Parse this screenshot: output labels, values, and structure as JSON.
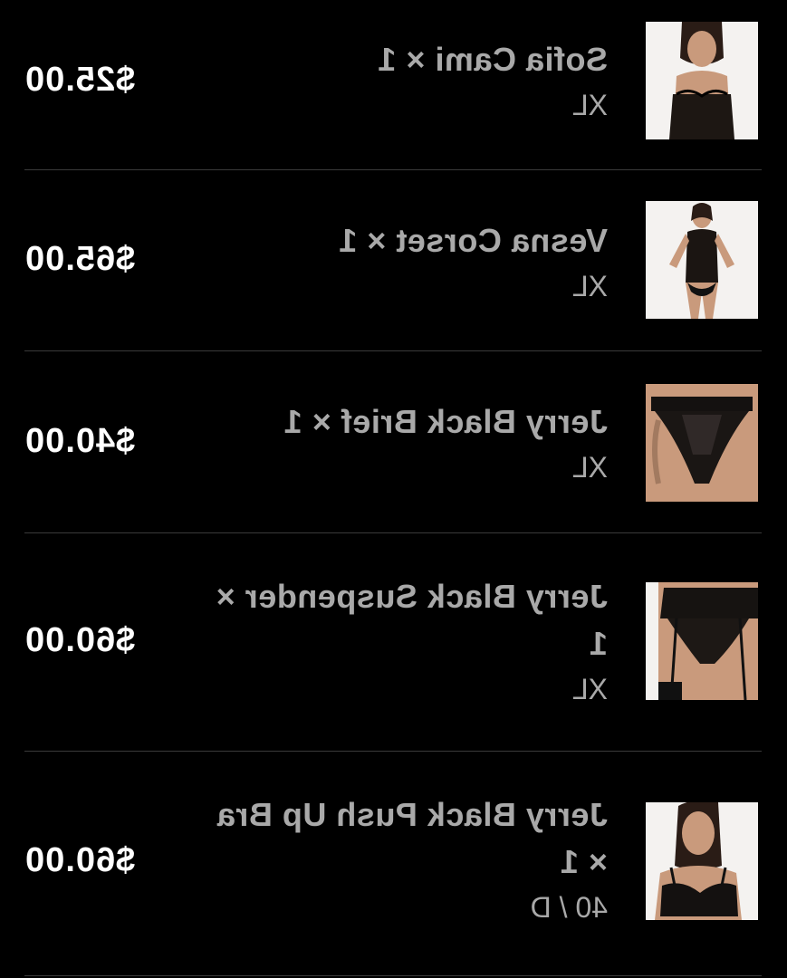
{
  "cart": {
    "items": [
      {
        "name": "Sofia Cami × 1",
        "variant": "XL",
        "price": "$25.00",
        "image_icon": "product-photo-cami"
      },
      {
        "name": "Vesna Corset × 1",
        "variant": "XL",
        "price": "$65.00",
        "image_icon": "product-photo-corset"
      },
      {
        "name": "Jerry Black Brief × 1",
        "variant": "XL",
        "price": "$40.00",
        "image_icon": "product-photo-brief"
      },
      {
        "name": "Jerry Black Suspender × 1",
        "variant": "XL",
        "price": "$60.00",
        "image_icon": "product-photo-suspender"
      },
      {
        "name": "Jerry Black Push Up Bra × 1",
        "variant": "40 / D",
        "price": "$60.00",
        "image_icon": "product-photo-bra"
      }
    ]
  },
  "colors": {
    "background": "#000000",
    "product_text": "#a9a9a9",
    "price_text": "#ffffff",
    "divider": "#3a3a3a"
  }
}
